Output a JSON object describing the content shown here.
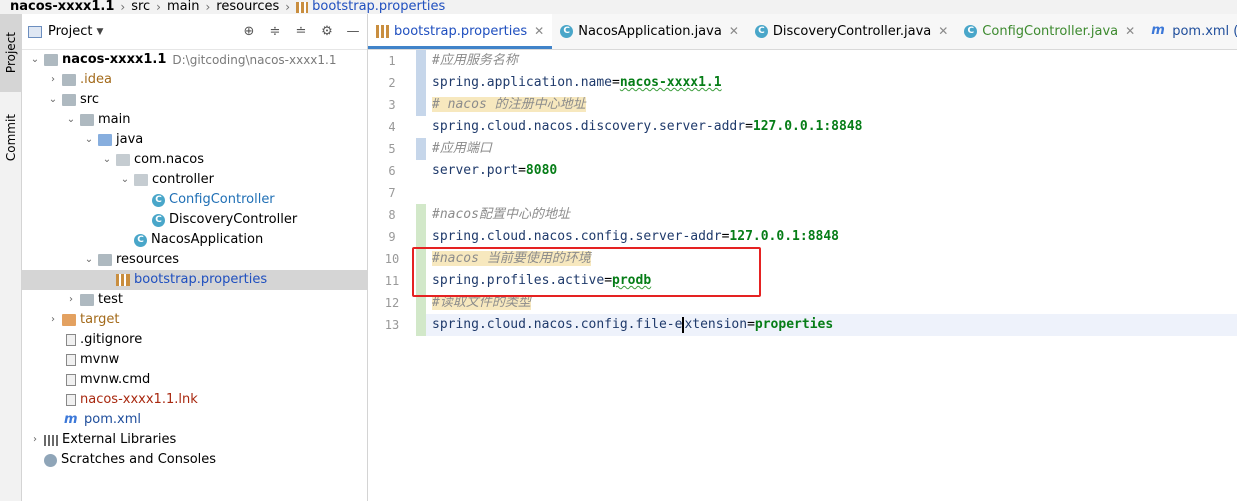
{
  "breadcrumb": {
    "items": [
      "nacos-xxxx1.1",
      "src",
      "main",
      "resources",
      "bootstrap.properties"
    ]
  },
  "toolstrip": {
    "project_label": "Project",
    "commit_label": "Commit"
  },
  "project_panel": {
    "title": "Project",
    "tree": {
      "root_name": "nacos-xxxx1.1",
      "root_path": "D:\\gitcoding\\nacos-xxxx1.1",
      "idea": ".idea",
      "src": "src",
      "main": "main",
      "java": "java",
      "pkg": "com.nacos",
      "controller": "controller",
      "config_controller": "ConfigController",
      "discovery_controller": "DiscoveryController",
      "nacos_application": "NacosApplication",
      "resources": "resources",
      "bootstrap": "bootstrap.properties",
      "test": "test",
      "target": "target",
      "gitignore": ".gitignore",
      "mvnw": "mvnw",
      "mvnw_cmd": "mvnw.cmd",
      "lnk": "nacos-xxxx1.1.lnk",
      "pom": "pom.xml",
      "external_libraries": "External Libraries",
      "scratches": "Scratches and Consoles"
    }
  },
  "editor": {
    "tabs": [
      {
        "label": "bootstrap.properties",
        "active": true
      },
      {
        "label": "NacosApplication.java",
        "active": false
      },
      {
        "label": "DiscoveryController.java",
        "active": false
      },
      {
        "label": "ConfigController.java",
        "active": false
      },
      {
        "label": "pom.xml (nacos)",
        "active": false
      }
    ],
    "lines": {
      "l1": {
        "num": "1",
        "comment": "#应用服务名称"
      },
      "l2": {
        "num": "2",
        "key": "spring.application.name",
        "eq": "=",
        "value": "nacos-xxxx1.1"
      },
      "l3": {
        "num": "3",
        "comment": "# nacos 的注册中心地址"
      },
      "l4": {
        "num": "4",
        "key": "spring.cloud.nacos.discovery.server-addr",
        "eq": "=",
        "value": "127.0.0.1:8848"
      },
      "l5": {
        "num": "5",
        "comment": "#应用端口"
      },
      "l6": {
        "num": "6",
        "key": "server.port",
        "eq": "=",
        "value": "8080"
      },
      "l7": {
        "num": "7"
      },
      "l8": {
        "num": "8",
        "comment": "#nacos配置中心的地址"
      },
      "l9": {
        "num": "9",
        "key": "spring.cloud.nacos.config.server-addr",
        "eq": "=",
        "value": "127.0.0.1:8848"
      },
      "l10": {
        "num": "10",
        "comment": "#nacos 当前要使用的环境"
      },
      "l11": {
        "num": "11",
        "key": "spring.profiles.active",
        "eq": "=",
        "value": "prodb"
      },
      "l12": {
        "num": "12",
        "comment": "#读取文件的类型"
      },
      "l13": {
        "num": "13",
        "key_a": "spring.cloud.nacos.config.file-e",
        "key_b": "xtension",
        "eq": "=",
        "value": "properties"
      }
    }
  },
  "colors": {
    "highlight_box": "#e52222",
    "active_tab_underline": "#4083c9",
    "value_green": "#067d17"
  }
}
